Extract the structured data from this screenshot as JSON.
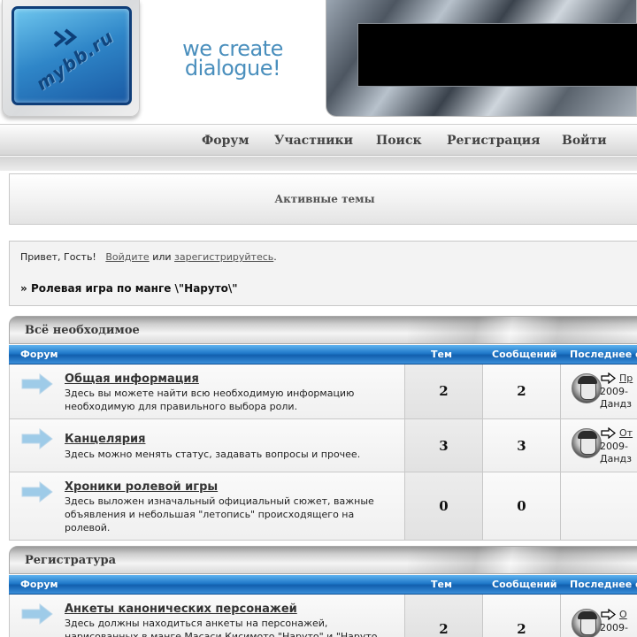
{
  "header": {
    "logo_text": "mybb.ru",
    "tagline_line1": "we create",
    "tagline_line2": "dialogue!"
  },
  "nav": {
    "items": [
      "Форум",
      "Участники",
      "Поиск",
      "Регистрация",
      "Войти"
    ]
  },
  "active_topics": {
    "label": "Активные темы"
  },
  "welcome": {
    "greeting": "Привет, Гость!",
    "login_link": "Войдите",
    "or": "или",
    "register_link": "зарегистрируйтесь",
    "period": ".",
    "breadcrumb_prefix": "»",
    "breadcrumb": "Ролевая игра по манге \\\"Наруто\\\""
  },
  "columns": {
    "forum": "Форум",
    "topics": "Тем",
    "posts": "Сообщений",
    "last": "Последнее с"
  },
  "categories": [
    {
      "title": "Всё необходимое",
      "forums": [
        {
          "name": "Общая информация",
          "desc": "Здесь вы можете найти всю необходимую информацию необходимую для правильного выбора роли.",
          "topics": "2",
          "posts": "2",
          "last_link": "Пр",
          "last_date": "2009-",
          "last_user": "Дандз"
        },
        {
          "name": "Канцелярия",
          "desc": "Здесь можно менять статус, задавать вопросы и прочее.",
          "topics": "3",
          "posts": "3",
          "last_link": "От",
          "last_date": "2009-",
          "last_user": "Дандз"
        },
        {
          "name": "Хроники ролевой игры",
          "desc": "Здесь выложен изначальный официальный сюжет, важные объявления и небольшая \"летопись\" происходящего на ролевой.",
          "topics": "0",
          "posts": "0"
        }
      ]
    },
    {
      "title": "Регистратура",
      "forums": [
        {
          "name": "Анкеты канонических персонажей",
          "desc": "Здесь должны находиться анкеты на персонажей, нарисованных в манге Масаси Кисимото \"Наруто\" и \"Наруто",
          "topics": "2",
          "posts": "2",
          "last_link": "О",
          "last_date": "2009-"
        }
      ]
    }
  ],
  "colors": {
    "column_header_blue": "#1f78c9",
    "tagline_blue": "#4a8fbd",
    "logo_blue": "#2f86c8"
  },
  "icons": {
    "forum": "forum-arrow-icon",
    "last_post": "go-to-post-icon"
  }
}
